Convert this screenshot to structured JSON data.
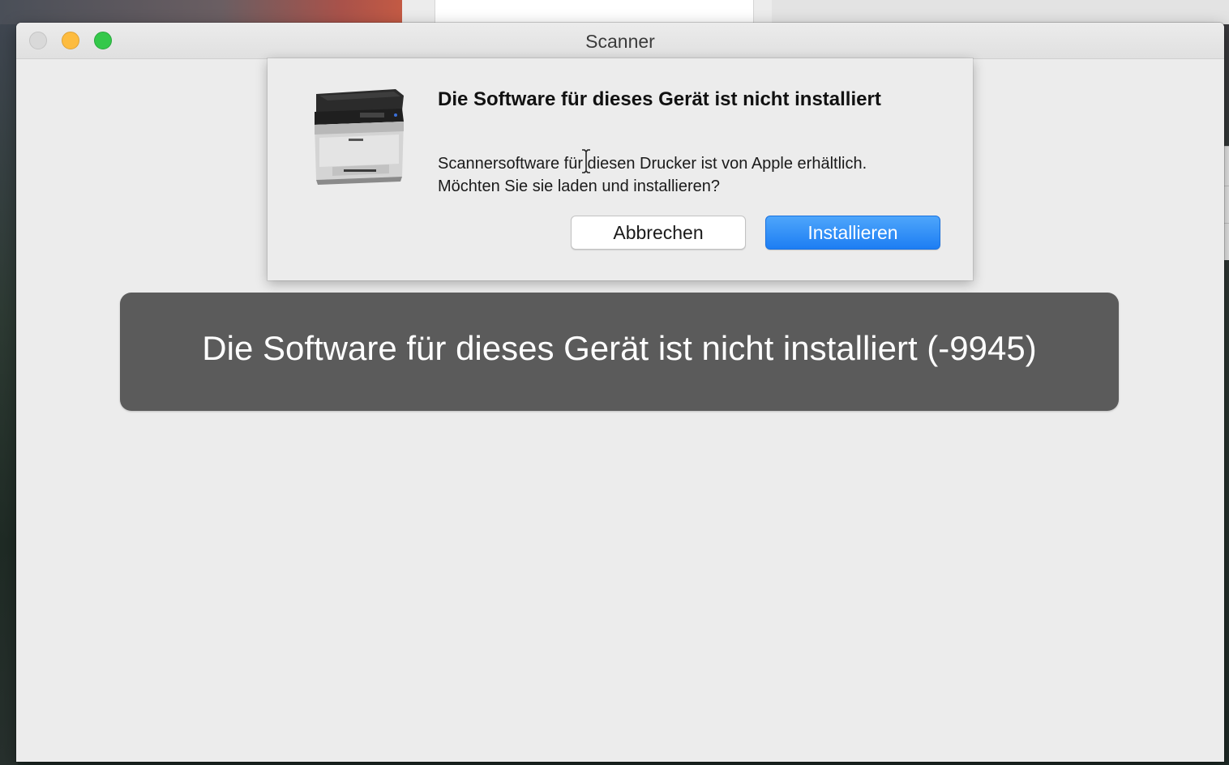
{
  "window": {
    "title": "Scanner"
  },
  "dialog": {
    "icon": "printer-icon",
    "title": "Die Software für dieses Gerät ist nicht installiert",
    "message": "Scannersoftware für diesen Drucker ist von Apple erhältlich. Möchten Sie sie laden und installieren?",
    "cancel_label": "Abbrechen",
    "install_label": "Installieren"
  },
  "status": {
    "error_message": "Die Software für dieses Gerät ist nicht installiert (-9945)"
  },
  "colors": {
    "accent": "#1d7ef3",
    "banner": "#5b5b5b",
    "close": "#d9d9d9",
    "minimize": "#fdbc40",
    "zoom": "#34c84a"
  }
}
